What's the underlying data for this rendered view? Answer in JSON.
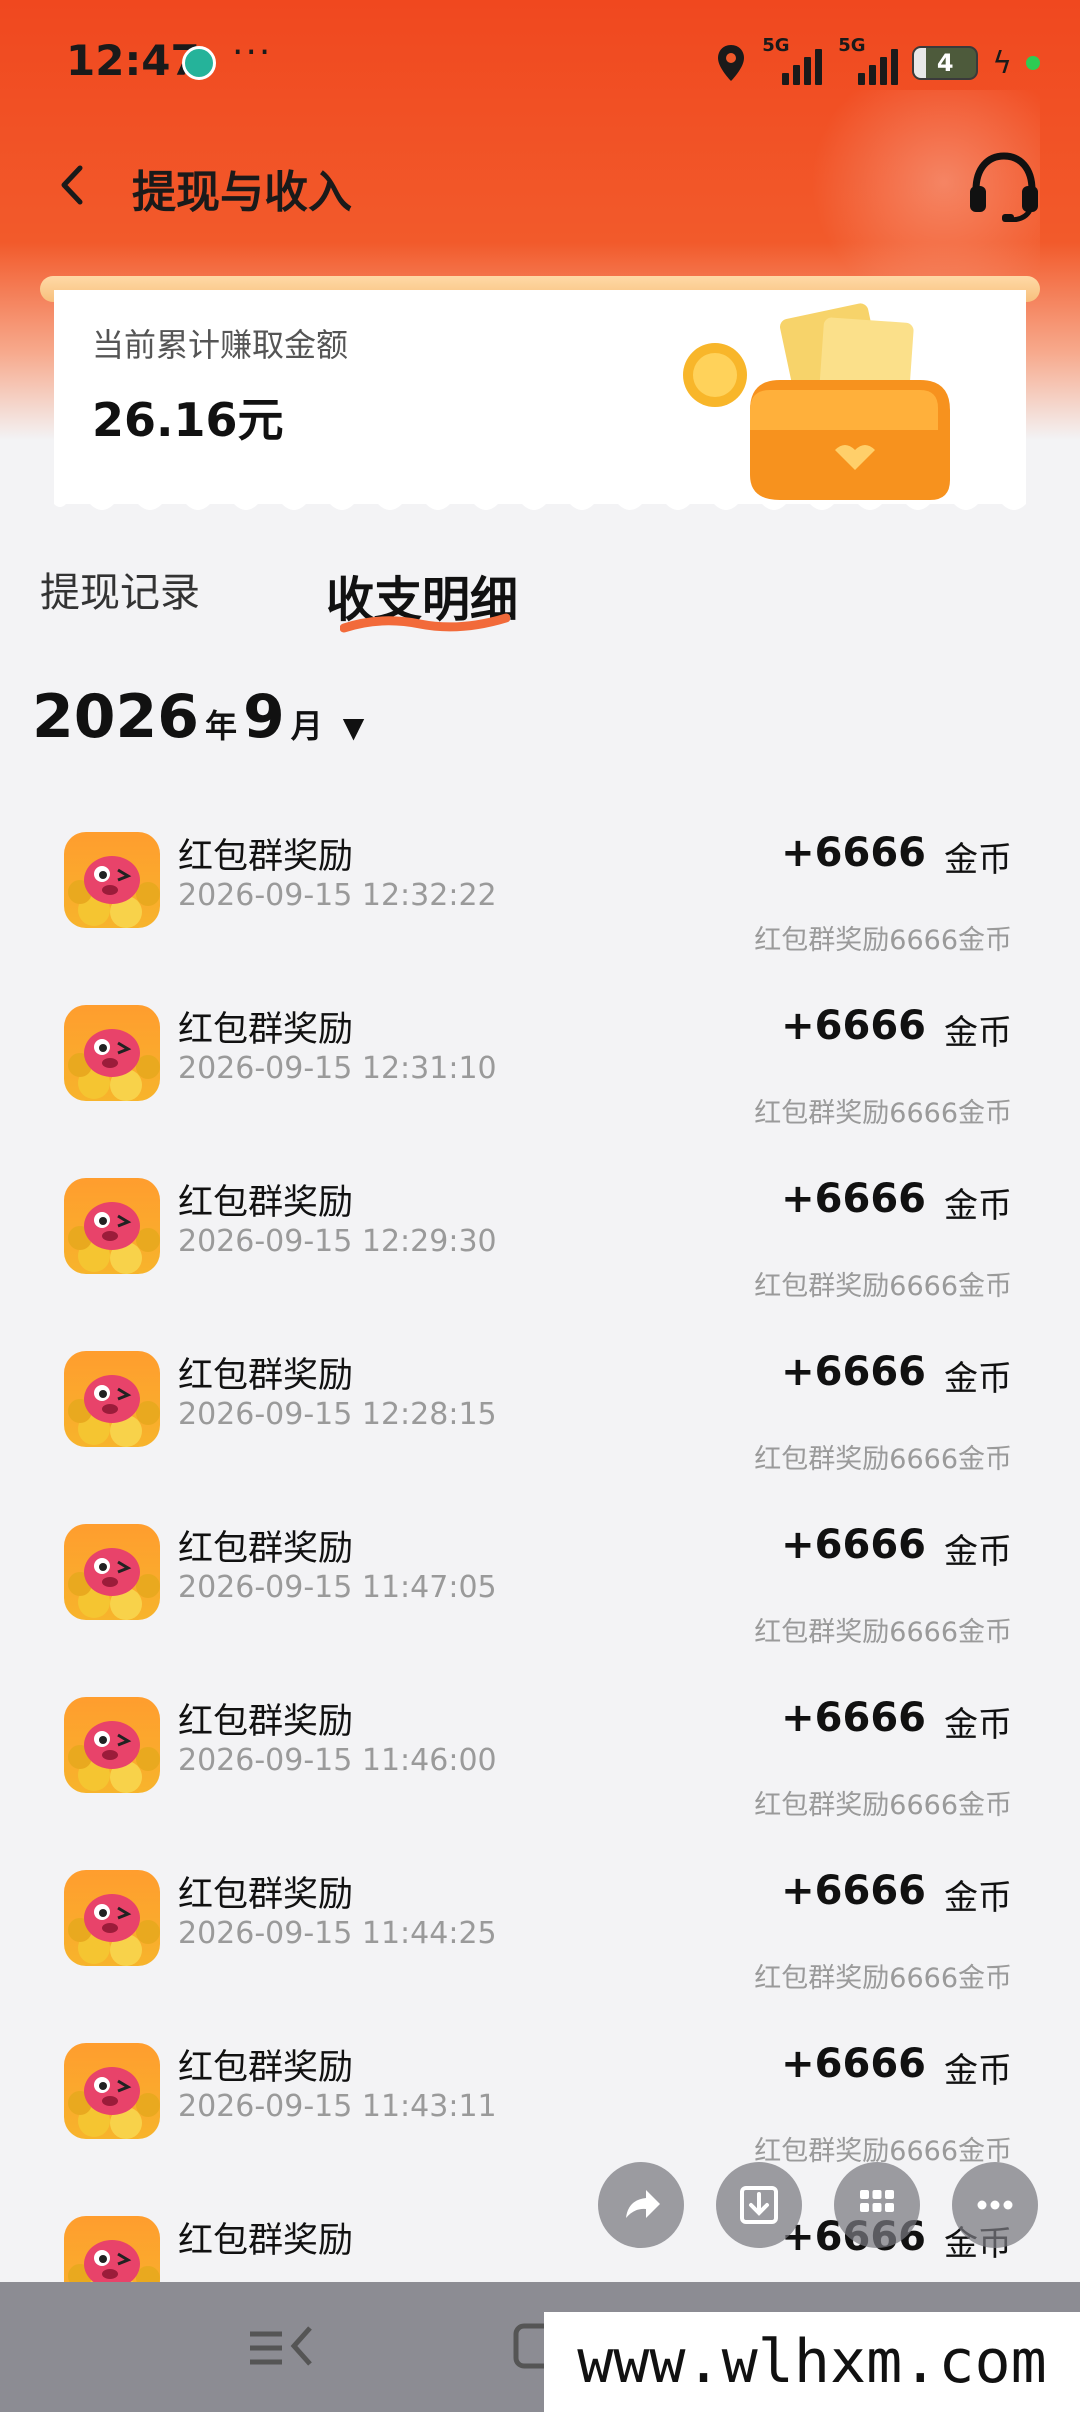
{
  "status_bar": {
    "time": "12:47",
    "more": "···",
    "network_1": "5G",
    "network_2": "5G",
    "battery": "4"
  },
  "nav": {
    "title": "提现与收入"
  },
  "card": {
    "label": "当前累计赚取金额",
    "amount": "26.16元"
  },
  "tabs": {
    "withdraw_records": "提现记录",
    "details": "收支明细",
    "active": "收支明细"
  },
  "month": {
    "year": "2026",
    "year_unit": "年",
    "month": "9",
    "month_unit": "月"
  },
  "records": [
    {
      "title": "红包群奖励",
      "time": "2026-09-15 12:32:22",
      "amount": "+6666",
      "unit": "金币",
      "note": "红包群奖励6666金币"
    },
    {
      "title": "红包群奖励",
      "time": "2026-09-15 12:31:10",
      "amount": "+6666",
      "unit": "金币",
      "note": "红包群奖励6666金币"
    },
    {
      "title": "红包群奖励",
      "time": "2026-09-15 12:29:30",
      "amount": "+6666",
      "unit": "金币",
      "note": "红包群奖励6666金币"
    },
    {
      "title": "红包群奖励",
      "time": "2026-09-15 12:28:15",
      "amount": "+6666",
      "unit": "金币",
      "note": "红包群奖励6666金币"
    },
    {
      "title": "红包群奖励",
      "time": "2026-09-15 11:47:05",
      "amount": "+6666",
      "unit": "金币",
      "note": "红包群奖励6666金币"
    },
    {
      "title": "红包群奖励",
      "time": "2026-09-15 11:46:00",
      "amount": "+6666",
      "unit": "金币",
      "note": "红包群奖励6666金币"
    },
    {
      "title": "红包群奖励",
      "time": "2026-09-15 11:44:25",
      "amount": "+6666",
      "unit": "金币",
      "note": "红包群奖励6666金币"
    },
    {
      "title": "红包群奖励",
      "time": "2026-09-15 11:43:11",
      "amount": "+6666",
      "unit": "金币",
      "note": "红包群奖励6666金币"
    },
    {
      "title": "红包群奖励",
      "time": "",
      "amount": "+6666",
      "unit": "金币",
      "note": ""
    }
  ],
  "fab_icons": [
    "share-icon",
    "download-icon",
    "apps-grid-icon",
    "more-icon"
  ],
  "watermark": "www.wlhxm.com",
  "colors": {
    "header": "#f0481f",
    "accent_underline": "#f26a3a",
    "background": "#f3f3f5"
  }
}
